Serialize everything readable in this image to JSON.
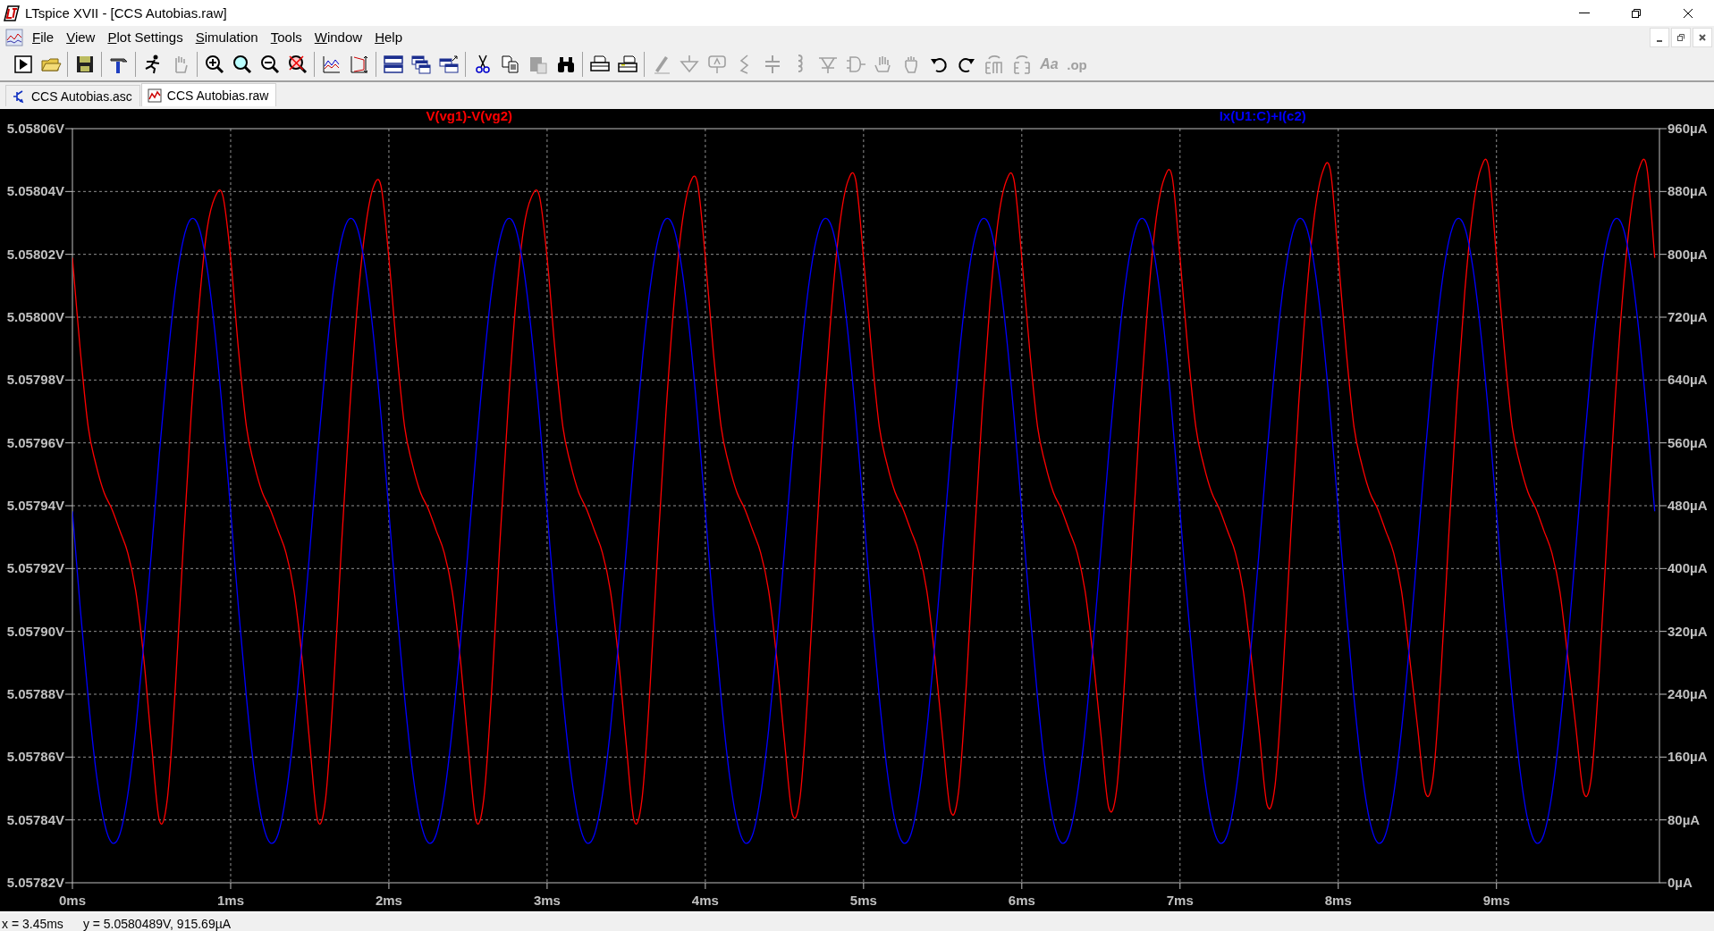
{
  "window": {
    "title": "LTspice XVII - [CCS Autobias.raw]"
  },
  "menu": [
    "File",
    "View",
    "Plot Settings",
    "Simulation",
    "Tools",
    "Window",
    "Help"
  ],
  "toolbar": [
    {
      "kind": "run",
      "disabled": false
    },
    {
      "kind": "open",
      "disabled": false
    },
    {
      "kind": "separator"
    },
    {
      "kind": "save",
      "disabled": false
    },
    {
      "kind": "separator"
    },
    {
      "kind": "control-panel",
      "disabled": false
    },
    {
      "kind": "separator"
    },
    {
      "kind": "pick",
      "disabled": false
    },
    {
      "kind": "pan",
      "disabled": true
    },
    {
      "kind": "separator"
    },
    {
      "kind": "zoom-in",
      "disabled": false
    },
    {
      "kind": "zoom-full",
      "disabled": false
    },
    {
      "kind": "zoom-out",
      "disabled": false
    },
    {
      "kind": "zoom-cancel",
      "disabled": false
    },
    {
      "kind": "separator"
    },
    {
      "kind": "autorange",
      "disabled": false
    },
    {
      "kind": "autorange-y",
      "disabled": false
    },
    {
      "kind": "separator"
    },
    {
      "kind": "tile-h",
      "disabled": false
    },
    {
      "kind": "cascade",
      "disabled": false
    },
    {
      "kind": "tile-v",
      "disabled": false
    },
    {
      "kind": "separator"
    },
    {
      "kind": "cut",
      "disabled": false
    },
    {
      "kind": "copy",
      "disabled": false
    },
    {
      "kind": "paste",
      "disabled": true
    },
    {
      "kind": "find",
      "disabled": false
    },
    {
      "kind": "separator"
    },
    {
      "kind": "print-preview",
      "disabled": false
    },
    {
      "kind": "print",
      "disabled": false
    },
    {
      "kind": "separator"
    },
    {
      "kind": "pencil",
      "disabled": true
    },
    {
      "kind": "ground",
      "disabled": true
    },
    {
      "kind": "label",
      "disabled": true
    },
    {
      "kind": "resistor",
      "disabled": true
    },
    {
      "kind": "capacitor",
      "disabled": true
    },
    {
      "kind": "inductor",
      "disabled": true
    },
    {
      "kind": "diode",
      "disabled": true
    },
    {
      "kind": "component",
      "disabled": true
    },
    {
      "kind": "drag",
      "disabled": true
    },
    {
      "kind": "move",
      "disabled": true
    },
    {
      "kind": "undo",
      "disabled": false
    },
    {
      "kind": "redo",
      "disabled": false
    },
    {
      "kind": "rotate",
      "disabled": true
    },
    {
      "kind": "mirror",
      "disabled": true
    },
    {
      "kind": "text",
      "disabled": true,
      "label": "Aa"
    },
    {
      "kind": "directive",
      "disabled": true,
      "label": ".op"
    }
  ],
  "tabs": [
    {
      "label": "CCS Autobias.asc",
      "kind": "schematic",
      "selected": false
    },
    {
      "label": "CCS Autobias.raw",
      "kind": "waveform",
      "selected": true
    }
  ],
  "plot": {
    "chart_data": {
      "type": "line",
      "grid": true,
      "xlim": [
        0,
        10.03
      ],
      "xticks": [
        {
          "value": 0,
          "label": "0ms"
        },
        {
          "value": 1,
          "label": "1ms"
        },
        {
          "value": 2,
          "label": "2ms"
        },
        {
          "value": 3,
          "label": "3ms"
        },
        {
          "value": 4,
          "label": "4ms"
        },
        {
          "value": 5,
          "label": "5ms"
        },
        {
          "value": 6,
          "label": "6ms"
        },
        {
          "value": 7,
          "label": "7ms"
        },
        {
          "value": 8,
          "label": "8ms"
        },
        {
          "value": 9,
          "label": "9ms"
        }
      ],
      "ylim": [
        5.05782,
        5.05806
      ],
      "yticks": [
        {
          "value": 5.05782,
          "label": "5.05782V"
        },
        {
          "value": 5.05784,
          "label": "5.05784V"
        },
        {
          "value": 5.05786,
          "label": "5.05786V"
        },
        {
          "value": 5.05788,
          "label": "5.05788V"
        },
        {
          "value": 5.0579,
          "label": "5.05790V"
        },
        {
          "value": 5.05792,
          "label": "5.05792V"
        },
        {
          "value": 5.05794,
          "label": "5.05794V"
        },
        {
          "value": 5.05796,
          "label": "5.05796V"
        },
        {
          "value": 5.05798,
          "label": "5.05798V"
        },
        {
          "value": 5.058,
          "label": "5.05800V"
        },
        {
          "value": 5.05802,
          "label": "5.05802V"
        },
        {
          "value": 5.05804,
          "label": "5.05804V"
        },
        {
          "value": 5.05806,
          "label": "5.05806V"
        }
      ],
      "y2lim": [
        0,
        960
      ],
      "y2ticks": [
        {
          "value": 0,
          "label": "0µA"
        },
        {
          "value": 80,
          "label": "80µA"
        },
        {
          "value": 160,
          "label": "160µA"
        },
        {
          "value": 240,
          "label": "240µA"
        },
        {
          "value": 320,
          "label": "320µA"
        },
        {
          "value": 400,
          "label": "400µA"
        },
        {
          "value": 480,
          "label": "480µA"
        },
        {
          "value": 560,
          "label": "560µA"
        },
        {
          "value": 640,
          "label": "640µA"
        },
        {
          "value": 720,
          "label": "720µA"
        },
        {
          "value": 800,
          "label": "800µA"
        },
        {
          "value": 880,
          "label": "880µA"
        },
        {
          "value": 960,
          "label": "960µA"
        }
      ],
      "x": [
        0,
        0.05,
        0.1,
        0.15,
        0.2,
        0.25,
        0.3,
        0.35,
        0.4,
        0.45,
        0.5,
        0.55,
        0.6,
        0.65,
        0.7,
        0.75,
        0.8,
        0.85,
        0.9,
        0.95,
        1,
        1.05,
        1.1,
        1.15,
        1.2,
        1.25,
        1.3,
        1.35,
        1.4,
        1.45,
        1.5,
        1.55,
        1.6,
        1.65,
        1.7,
        1.75,
        1.8,
        1.85,
        1.9,
        1.95,
        2,
        2.05,
        2.1,
        2.15,
        2.2,
        2.25,
        2.3,
        2.35,
        2.4,
        2.45,
        2.5,
        2.55,
        2.6,
        2.65,
        2.7,
        2.75,
        2.8,
        2.85,
        2.9,
        2.95,
        3,
        3.05,
        3.1,
        3.15,
        3.2,
        3.25,
        3.3,
        3.35,
        3.4,
        3.45,
        3.5,
        3.55,
        3.6,
        3.65,
        3.7,
        3.75,
        3.8,
        3.85,
        3.9,
        3.95,
        4,
        4.05,
        4.1,
        4.15,
        4.2,
        4.25,
        4.3,
        4.35,
        4.4,
        4.45,
        4.5,
        4.55,
        4.6,
        4.65,
        4.7,
        4.75,
        4.8,
        4.85,
        4.9,
        4.95,
        5,
        5.05,
        5.1,
        5.15,
        5.2,
        5.25,
        5.3,
        5.35,
        5.4,
        5.45,
        5.5,
        5.55,
        5.6,
        5.65,
        5.7,
        5.75,
        5.8,
        5.85,
        5.9,
        5.95,
        6,
        6.05,
        6.1,
        6.15,
        6.2,
        6.25,
        6.3,
        6.35,
        6.4,
        6.45,
        6.5,
        6.55,
        6.6,
        6.65,
        6.7,
        6.75,
        6.8,
        6.85,
        6.9,
        6.95,
        7,
        7.05,
        7.1,
        7.15,
        7.2,
        7.25,
        7.3,
        7.35,
        7.4,
        7.45,
        7.5,
        7.55,
        7.6,
        7.65,
        7.7,
        7.75,
        7.8,
        7.85,
        7.9,
        7.95,
        8,
        8.05,
        8.1,
        8.15,
        8.2,
        8.25,
        8.3,
        8.35,
        8.4,
        8.45,
        8.5,
        8.55,
        8.6,
        8.65,
        8.7,
        8.75,
        8.8,
        8.85,
        8.9,
        8.95,
        9,
        9.05,
        9.1,
        9.15,
        9.2,
        9.25,
        9.3,
        9.35,
        9.4,
        9.45,
        9.5,
        9.55,
        9.6,
        9.65,
        9.7,
        9.75,
        9.8,
        9.85,
        9.9,
        9.95,
        10
      ],
      "series": [
        {
          "name": "V(vg1)-V(vg2)",
          "color": "#ff0000",
          "values": [
            5.0580189,
            5.0579894,
            5.057965,
            5.0579529,
            5.0579442,
            5.0579389,
            5.057932,
            5.057925,
            5.0579129,
            5.057892,
            5.0578642,
            5.0578398,
            5.0578468,
            5.0578816,
            5.0579268,
            5.0579685,
            5.0580033,
            5.0580276,
            5.0580381,
            5.0580388,
            5.0580189,
            5.0579894,
            5.057965,
            5.0579529,
            5.0579442,
            5.0579389,
            5.057932,
            5.057925,
            5.0579129,
            5.057892,
            5.0578642,
            5.0578398,
            5.0578468,
            5.0578816,
            5.0579268,
            5.0579685,
            5.0580033,
            5.0580276,
            5.0580411,
            5.0580418,
            5.0580189,
            5.0579894,
            5.057965,
            5.0579529,
            5.0579442,
            5.0579389,
            5.057932,
            5.057925,
            5.0579129,
            5.057892,
            5.0578642,
            5.0578398,
            5.0578468,
            5.0578816,
            5.0579268,
            5.0579685,
            5.0580033,
            5.0580276,
            5.0580381,
            5.0580388,
            5.0580189,
            5.0579894,
            5.057965,
            5.0579529,
            5.0579442,
            5.0579389,
            5.057932,
            5.057925,
            5.0579129,
            5.057892,
            5.0578642,
            5.0578398,
            5.0578468,
            5.0578816,
            5.0579268,
            5.0579685,
            5.0580033,
            5.0580286,
            5.0580421,
            5.0580428,
            5.0580189,
            5.0579894,
            5.057965,
            5.0579529,
            5.0579442,
            5.0579389,
            5.057932,
            5.057925,
            5.0579129,
            5.057892,
            5.0578652,
            5.0578418,
            5.0578478,
            5.0578826,
            5.0579278,
            5.0579695,
            5.0580043,
            5.0580296,
            5.0580431,
            5.0580438,
            5.0580189,
            5.0579894,
            5.057965,
            5.0579529,
            5.0579442,
            5.0579389,
            5.057932,
            5.057925,
            5.0579129,
            5.057892,
            5.0578662,
            5.0578428,
            5.0578488,
            5.0578836,
            5.0579288,
            5.0579705,
            5.0580053,
            5.0580306,
            5.0580431,
            5.0580438,
            5.0580189,
            5.0579894,
            5.057965,
            5.0579529,
            5.0579442,
            5.0579389,
            5.057932,
            5.057925,
            5.0579129,
            5.057892,
            5.0578672,
            5.0578438,
            5.0578498,
            5.0578846,
            5.0579298,
            5.0579715,
            5.0580063,
            5.0580316,
            5.0580441,
            5.0580448,
            5.0580189,
            5.0579894,
            5.057965,
            5.0579529,
            5.0579442,
            5.0579389,
            5.057932,
            5.057925,
            5.0579129,
            5.057892,
            5.0578682,
            5.0578448,
            5.0578508,
            5.0578856,
            5.0579308,
            5.0579725,
            5.0580073,
            5.0580326,
            5.0580461,
            5.0580468,
            5.0580189,
            5.0579894,
            5.057965,
            5.0579529,
            5.0579442,
            5.0579389,
            5.057932,
            5.057925,
            5.0579129,
            5.057892,
            5.0578702,
            5.0578488,
            5.0578538,
            5.0578876,
            5.0579318,
            5.0579735,
            5.0580083,
            5.0580336,
            5.0580471,
            5.0580478,
            5.0580189,
            5.0579894,
            5.057965,
            5.0579529,
            5.0579442,
            5.0579389,
            5.057932,
            5.057925,
            5.0579129,
            5.057892,
            5.0578702,
            5.0578488,
            5.0578538,
            5.0578876,
            5.0579318,
            5.0579735,
            5.0580083,
            5.0580336,
            5.0580471,
            5.0580478,
            5.0580189
          ]
        },
        {
          "name": "Ix(U1:C)+I(c2)",
          "color": "#0000ff",
          "axis": "y2",
          "values": [
            473,
            349,
            235,
            141,
            78,
            51,
            62,
            112,
            195,
            302,
            423,
            547,
            661,
            755,
            818,
            845,
            834,
            784,
            702,
            595,
            473,
            349,
            235,
            141,
            78,
            51,
            62,
            112,
            195,
            302,
            423,
            547,
            661,
            755,
            818,
            845,
            834,
            784,
            702,
            595,
            473,
            349,
            235,
            141,
            78,
            51,
            62,
            112,
            195,
            302,
            423,
            547,
            661,
            755,
            818,
            845,
            834,
            784,
            702,
            595,
            473,
            349,
            235,
            141,
            78,
            51,
            62,
            112,
            195,
            302,
            423,
            547,
            661,
            755,
            818,
            845,
            834,
            784,
            702,
            595,
            473,
            349,
            235,
            141,
            78,
            51,
            62,
            112,
            195,
            302,
            423,
            547,
            661,
            755,
            818,
            845,
            834,
            784,
            702,
            595,
            473,
            349,
            235,
            141,
            78,
            51,
            62,
            112,
            195,
            302,
            423,
            547,
            661,
            755,
            818,
            845,
            834,
            784,
            702,
            595,
            473,
            349,
            235,
            141,
            78,
            51,
            62,
            112,
            195,
            302,
            423,
            547,
            661,
            755,
            818,
            845,
            834,
            784,
            702,
            595,
            473,
            349,
            235,
            141,
            78,
            51,
            62,
            112,
            195,
            302,
            423,
            547,
            661,
            755,
            818,
            845,
            834,
            784,
            702,
            595,
            473,
            349,
            235,
            141,
            78,
            51,
            62,
            112,
            195,
            302,
            423,
            547,
            661,
            755,
            818,
            845,
            834,
            784,
            702,
            595,
            473,
            349,
            235,
            141,
            78,
            51,
            62,
            112,
            195,
            302,
            423,
            547,
            661,
            755,
            818,
            845,
            834,
            784,
            702,
            595,
            473
          ]
        }
      ]
    }
  },
  "status_bar": [
    "x = 3.45ms",
    "y = 5.0580489V, 915.69µA"
  ]
}
